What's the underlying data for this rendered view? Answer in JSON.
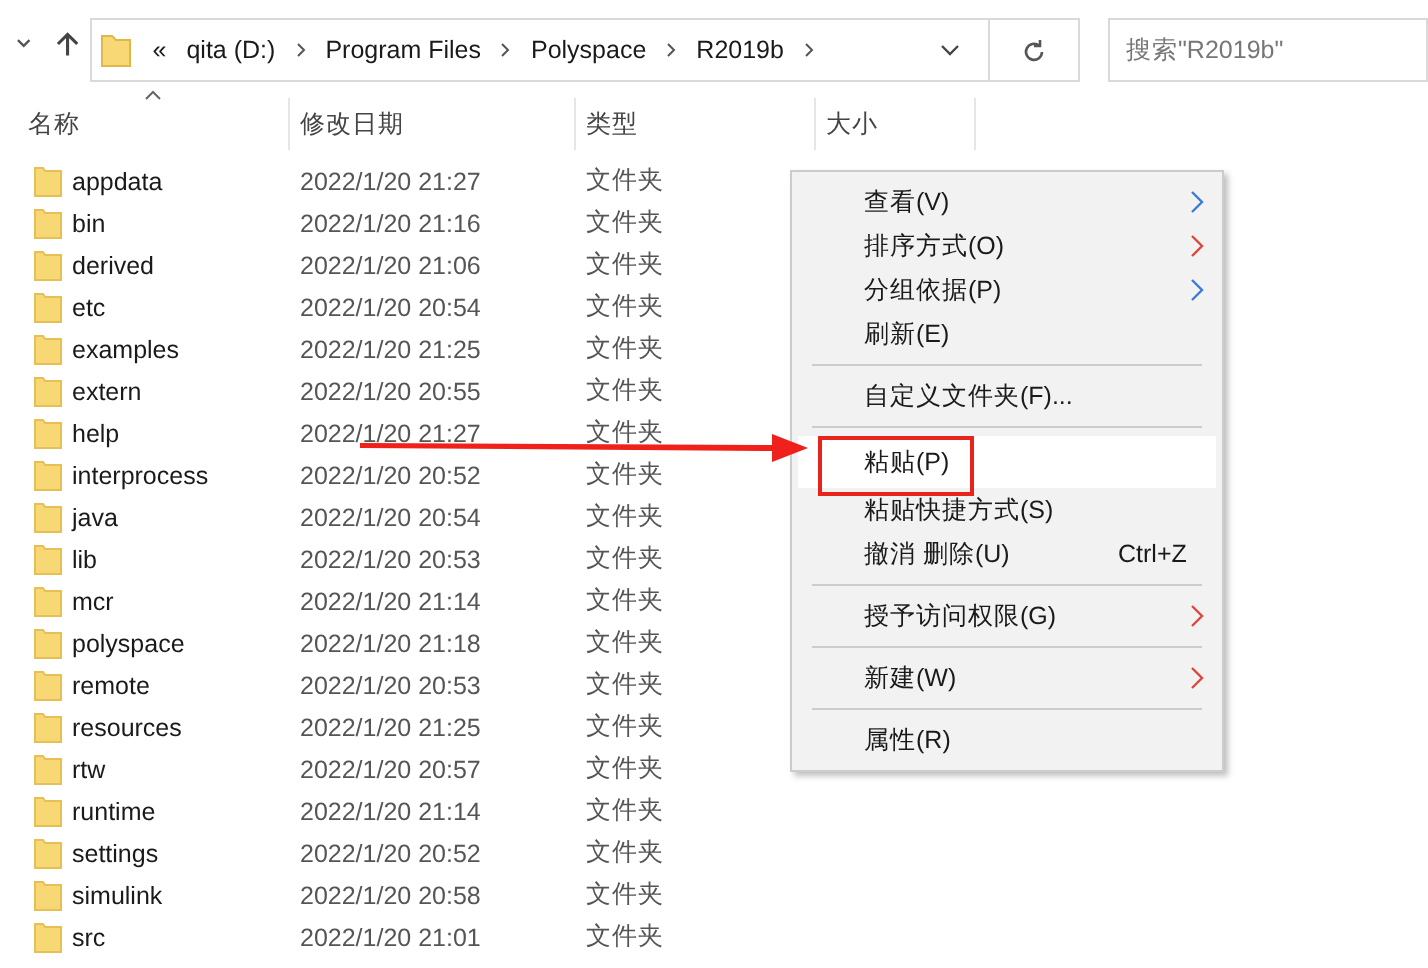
{
  "address_bar": {
    "overflow": "«",
    "path": [
      "qita (D:)",
      "Program Files",
      "Polyspace",
      "R2019b"
    ]
  },
  "search": {
    "placeholder": "搜索\"R2019b\""
  },
  "columns": [
    {
      "label": "名称",
      "sorted": true
    },
    {
      "label": "修改日期",
      "sorted": false
    },
    {
      "label": "类型",
      "sorted": false
    },
    {
      "label": "大小",
      "sorted": false
    }
  ],
  "files": [
    {
      "name": "appdata",
      "modified": "2022/1/20 21:27",
      "type": "文件夹"
    },
    {
      "name": "bin",
      "modified": "2022/1/20 21:16",
      "type": "文件夹"
    },
    {
      "name": "derived",
      "modified": "2022/1/20 21:06",
      "type": "文件夹"
    },
    {
      "name": "etc",
      "modified": "2022/1/20 20:54",
      "type": "文件夹"
    },
    {
      "name": "examples",
      "modified": "2022/1/20 21:25",
      "type": "文件夹"
    },
    {
      "name": "extern",
      "modified": "2022/1/20 20:55",
      "type": "文件夹"
    },
    {
      "name": "help",
      "modified": "2022/1/20 21:27",
      "type": "文件夹"
    },
    {
      "name": "interprocess",
      "modified": "2022/1/20 20:52",
      "type": "文件夹"
    },
    {
      "name": "java",
      "modified": "2022/1/20 20:54",
      "type": "文件夹"
    },
    {
      "name": "lib",
      "modified": "2022/1/20 20:53",
      "type": "文件夹"
    },
    {
      "name": "mcr",
      "modified": "2022/1/20 21:14",
      "type": "文件夹"
    },
    {
      "name": "polyspace",
      "modified": "2022/1/20 21:18",
      "type": "文件夹"
    },
    {
      "name": "remote",
      "modified": "2022/1/20 20:53",
      "type": "文件夹"
    },
    {
      "name": "resources",
      "modified": "2022/1/20 21:25",
      "type": "文件夹"
    },
    {
      "name": "rtw",
      "modified": "2022/1/20 20:57",
      "type": "文件夹"
    },
    {
      "name": "runtime",
      "modified": "2022/1/20 21:14",
      "type": "文件夹"
    },
    {
      "name": "settings",
      "modified": "2022/1/20 20:52",
      "type": "文件夹"
    },
    {
      "name": "simulink",
      "modified": "2022/1/20 20:58",
      "type": "文件夹"
    },
    {
      "name": "src",
      "modified": "2022/1/20 21:01",
      "type": "文件夹"
    }
  ],
  "context_menu": [
    {
      "kind": "item",
      "label": "查看(V)",
      "submenu": true,
      "color": "#3a7bd5",
      "selected": false
    },
    {
      "kind": "item",
      "label": "排序方式(O)",
      "submenu": true,
      "color": "#e0453a",
      "selected": false
    },
    {
      "kind": "item",
      "label": "分组依据(P)",
      "submenu": true,
      "color": "#3a7bd5",
      "selected": false
    },
    {
      "kind": "item",
      "label": "刷新(E)",
      "submenu": false,
      "selected": false
    },
    {
      "kind": "separator"
    },
    {
      "kind": "item",
      "label": "自定义文件夹(F)...",
      "submenu": false,
      "selected": false
    },
    {
      "kind": "separator"
    },
    {
      "kind": "item",
      "label": "粘贴(P)",
      "submenu": false,
      "selected": true,
      "annotated": true
    },
    {
      "kind": "item",
      "label": "粘贴快捷方式(S)",
      "submenu": false,
      "selected": false
    },
    {
      "kind": "item",
      "label": "撤消 删除(U)",
      "shortcut": "Ctrl+Z",
      "submenu": false,
      "selected": false
    },
    {
      "kind": "separator"
    },
    {
      "kind": "item",
      "label": "授予访问权限(G)",
      "submenu": true,
      "color": "#e0453a",
      "selected": false
    },
    {
      "kind": "separator"
    },
    {
      "kind": "item",
      "label": "新建(W)",
      "submenu": true,
      "color": "#e0453a",
      "selected": false
    },
    {
      "kind": "separator"
    },
    {
      "kind": "item",
      "label": "属性(R)",
      "submenu": false,
      "selected": false
    }
  ]
}
